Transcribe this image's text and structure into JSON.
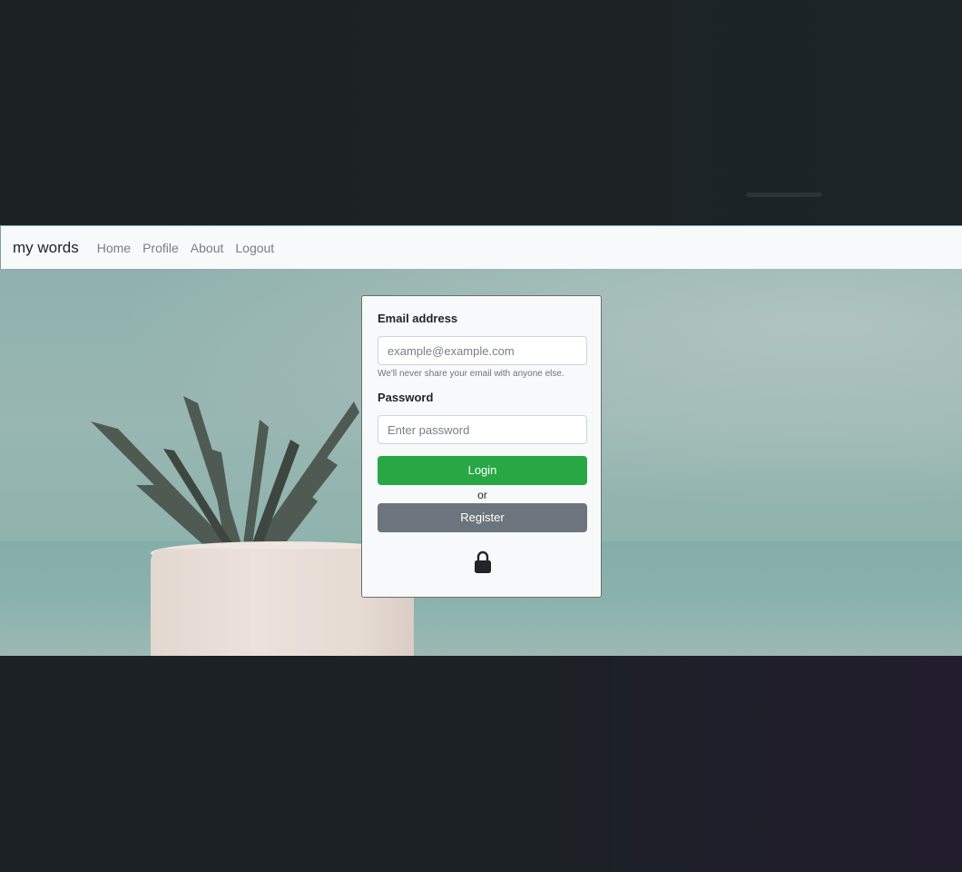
{
  "navbar": {
    "brand": "my words",
    "links": [
      "Home",
      "Profile",
      "About",
      "Logout"
    ]
  },
  "form": {
    "email_label": "Email address",
    "email_placeholder": "example@example.com",
    "email_help": "We'll never share your email with anyone else.",
    "password_label": "Password",
    "password_placeholder": "Enter password",
    "login_label": "Login",
    "or_text": "or",
    "register_label": "Register",
    "lock_icon": "lock-icon"
  },
  "colors": {
    "login": "#28a745",
    "register": "#6c757d",
    "navbar_bg": "#f8f9fa"
  }
}
